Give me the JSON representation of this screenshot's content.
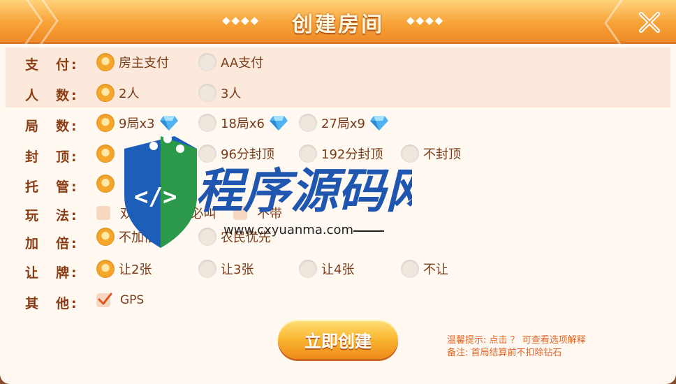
{
  "header": {
    "title": "创建房间",
    "deco_left": "◆◆◆◆",
    "deco_right": "◆◆◆◆"
  },
  "rows": {
    "pay": {
      "label": "支　付:",
      "options": [
        "房主支付",
        "AA支付"
      ]
    },
    "players": {
      "label": "人　数:",
      "options": [
        "2人",
        "3人"
      ]
    },
    "rounds": {
      "label": "局　数:",
      "options": [
        "9局x3",
        "18局x6",
        "27局x9"
      ]
    },
    "cap": {
      "label": "封　顶:",
      "options": [
        "",
        "96分封顶",
        "192分封顶",
        "不封顶"
      ]
    },
    "hosting": {
      "label": "托　管:"
    },
    "play": {
      "label": "玩　法:",
      "options": [
        "双王或4个二必叫",
        "不带"
      ]
    },
    "double": {
      "label": "加　倍:",
      "options": [
        "不加倍",
        "农民优先"
      ]
    },
    "concede": {
      "label": "让　牌:",
      "options": [
        "让2张",
        "让3张",
        "让4张",
        "不让"
      ]
    },
    "other": {
      "label": "其　他:",
      "options": [
        "GPS"
      ]
    }
  },
  "create_button": "立即创建",
  "hints": {
    "line1": "温馨提示: 点击 ？ 可查看选项解释",
    "line2": "备注: 首局结算前不扣除钻石"
  },
  "watermark": {
    "title": "程序源码网",
    "url": "www.cxyuanma.com"
  },
  "colors": {
    "accent": "#f7a338",
    "label": "#8a3c14",
    "hint": "#e2662a"
  }
}
